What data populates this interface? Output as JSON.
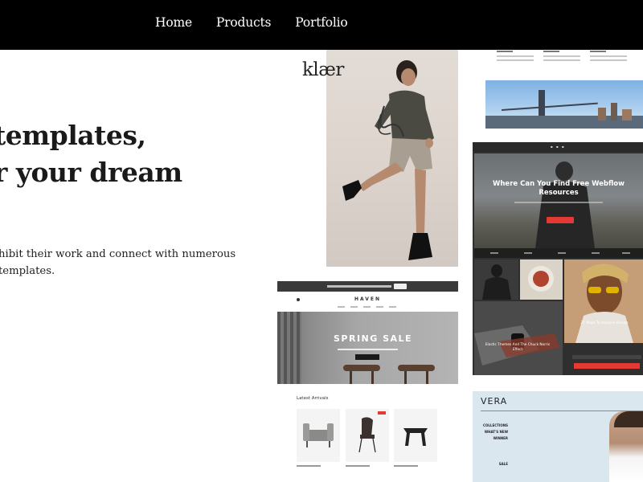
{
  "nav": {
    "items": [
      {
        "label": "Home"
      },
      {
        "label": "Products"
      },
      {
        "label": "Portfolio"
      }
    ]
  },
  "hero": {
    "title_line1": "templates,",
    "title_line2": "r your dream",
    "subtitle_line1": "hibit their work and connect with numerous",
    "subtitle_line2": "templates."
  },
  "templates": {
    "klaer": {
      "logo": "klær"
    },
    "haven": {
      "logo": "HAVEN",
      "banner": "SPRING SALE",
      "section": "Latest Arrivals"
    },
    "resource": {
      "title": "Where Can You Find Free Webflow Resources",
      "tile1": "27 Ways To Improve Design",
      "tile2": "Elastic Themes And The Chuck Norris Effect"
    },
    "vera": {
      "logo": "VERA",
      "menu": [
        "COLLECTIONS",
        "WHAT'S NEW",
        "WINNER",
        "SALE"
      ]
    }
  },
  "colors": {
    "nav_bg": "#000000",
    "accent_red": "#e53935"
  }
}
